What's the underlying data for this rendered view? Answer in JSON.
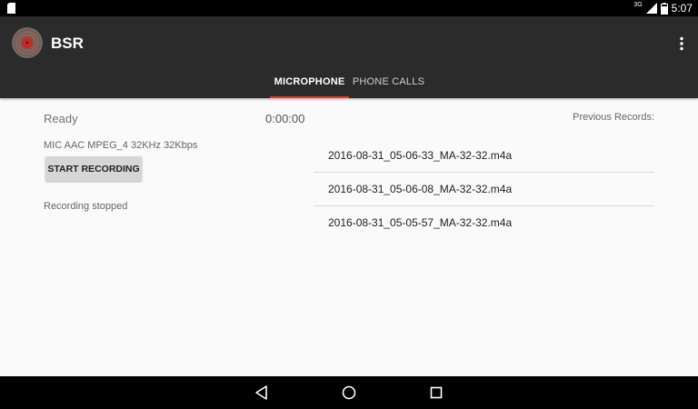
{
  "status_bar": {
    "time": "5:07",
    "network": "3G",
    "icons": [
      "sd-card-icon",
      "signal-icon",
      "battery-icon"
    ]
  },
  "app": {
    "title": "BSR",
    "overflow_icon": "more-vert-icon"
  },
  "tabs": [
    {
      "label": "MICROPHONE",
      "active": true
    },
    {
      "label": "PHONE CALLS",
      "active": false
    }
  ],
  "recorder": {
    "status": "Ready",
    "timer": "0:00:00",
    "codec_info": "MIC AAC MPEG_4 32KHz 32Kbps",
    "start_button": "START RECORDING",
    "recording_status": "Recording stopped"
  },
  "records": {
    "label": "Previous Records:",
    "items": [
      "2016-08-31_05-06-33_MA-32-32.m4a",
      "2016-08-31_05-06-08_MA-32-32.m4a",
      "2016-08-31_05-05-57_MA-32-32.m4a"
    ]
  },
  "nav_bar": {
    "icons": [
      "back-icon",
      "home-icon",
      "recents-icon"
    ]
  },
  "colors": {
    "app_bar": "#2b2b2b",
    "tab_indicator": "#e53935",
    "background": "#fafafa"
  }
}
